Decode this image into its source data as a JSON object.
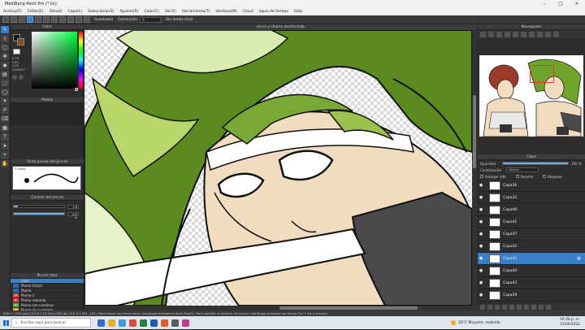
{
  "window": {
    "title": "MediBang Paint Pro (*.lin)"
  },
  "menu": [
    "Archivo(F)",
    "Editar(E)",
    "Filtro(I)",
    "Capa(L)",
    "Seleccionar(S)",
    "Ajustes(R)",
    "Color(C)",
    "Ver(V)",
    "Herramienta(T)",
    "Ventana(W)",
    "Cloud",
    "lapso de tiempo",
    "Help"
  ],
  "toolbar": {
    "suavizado_label": "Suavizado",
    "correccion_label": "Corrección",
    "correccion_value": "0",
    "sin_guias_label": "Sin líneas Guía"
  },
  "color_panel": {
    "title": "Color",
    "hsv_text": [
      "H:76",
      "S:84",
      "V:15"
    ],
    "hex": "#4AB017"
  },
  "palette_panel": {
    "title": "Paleta"
  },
  "brush_preview": {
    "title": "Vista previa del pincel",
    "size_label": "3 Aliasz"
  },
  "brush_control": {
    "title": "Control del pincel",
    "size_value": "3.8",
    "opacity_value": "100 %",
    "size_fill": 0.08,
    "opacity_fill": 1.0
  },
  "brush_list": {
    "title": "Pincel (día)",
    "items": [
      {
        "num": "",
        "label": "Lápiz",
        "color": "#3a7fc9",
        "active": true
      },
      {
        "num": "",
        "label": "Pluma (tinta)",
        "color": "#2a6ab3",
        "active": false
      },
      {
        "num": "",
        "label": "Pluma",
        "color": "#2a6ab3",
        "active": false
      },
      {
        "num": "16",
        "label": "Pluma G",
        "color": "#d9463a",
        "active": false
      },
      {
        "num": "8",
        "label": "Pluma redonda",
        "color": "#d9463a",
        "active": false
      },
      {
        "num": "20",
        "label": "Pluma con contorno",
        "color": "#4caf50",
        "active": false
      },
      {
        "num": "20",
        "label": "Pluma de punteado",
        "color": "#e0a020",
        "active": false
      }
    ]
  },
  "canvas": {
    "tab_title": "shiva y shaina medio.mdp"
  },
  "navigator": {
    "title": "Navegador"
  },
  "layer_panel": {
    "title": "Capa",
    "opacity_label": "Opacidad",
    "opacity_value": "100 %",
    "blend_label": "Combinación",
    "blend_value": "Normal",
    "protect_alpha": "Proteger alfa",
    "clipping": "Recorte",
    "lock": "Bloquear",
    "layers": [
      {
        "name": "Capa36",
        "active": false
      },
      {
        "name": "Capa32",
        "active": false
      },
      {
        "name": "Capa40",
        "active": false
      },
      {
        "name": "Capa41",
        "active": false
      },
      {
        "name": "Capa37",
        "active": false
      },
      {
        "name": "Capa42",
        "active": false
      },
      {
        "name": "Capa43",
        "active": true
      },
      {
        "name": "Capa44",
        "active": false
      },
      {
        "name": "Capa43",
        "active": false
      },
      {
        "name": "Capa39",
        "active": false
      }
    ]
  },
  "status": {
    "text": "1600 * 1200 pixel   (13.6 * 10.2cm)   350 dpi   100 %   ( 931, 242 )   Para trazar una línea recta, mantenga pulsada la tecla Mayús. Para cambiar el tamaño del pincel, mantenga pulsadas las teclas Ctrl + Alt y arrastre"
  },
  "taskbar": {
    "search_placeholder": "Escribe aquí para buscar",
    "weather": "28°C  Mayorm. nublado",
    "time": "04:48 p. m.",
    "date": "15/06/2022"
  },
  "colors": {
    "accent": "#3a7fc9",
    "hair_green": "#5b8a1f",
    "hair_light": "#b9d66a",
    "skin": "#f1dcc0"
  }
}
